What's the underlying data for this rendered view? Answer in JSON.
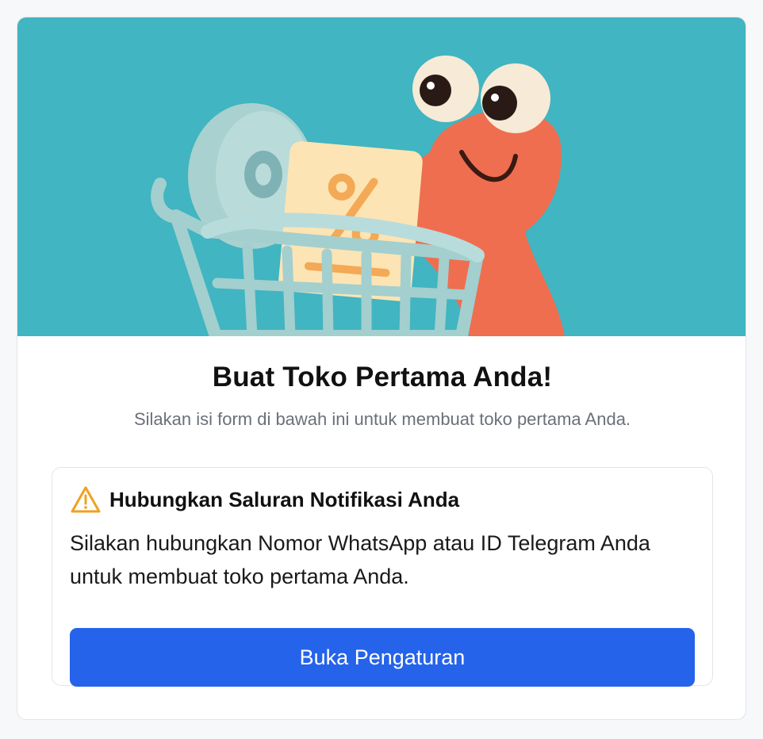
{
  "hero": {
    "illustration": "shopping-cart-with-discount-tags-and-smiling-worm",
    "background_color": "#41b5c1"
  },
  "page": {
    "title": "Buat Toko Pertama Anda!",
    "subtitle": "Silakan isi form di bawah ini untuk membuat toko pertama Anda."
  },
  "notice": {
    "icon": "warning-icon",
    "icon_color": "#f0a020",
    "title": "Hubungkan Saluran Notifikasi Anda",
    "body": "Silakan hubungkan Nomor WhatsApp atau ID Telegram Anda untuk membuat toko pertama Anda.",
    "button_label": "Buka Pengaturan",
    "button_color": "#2563eb"
  }
}
